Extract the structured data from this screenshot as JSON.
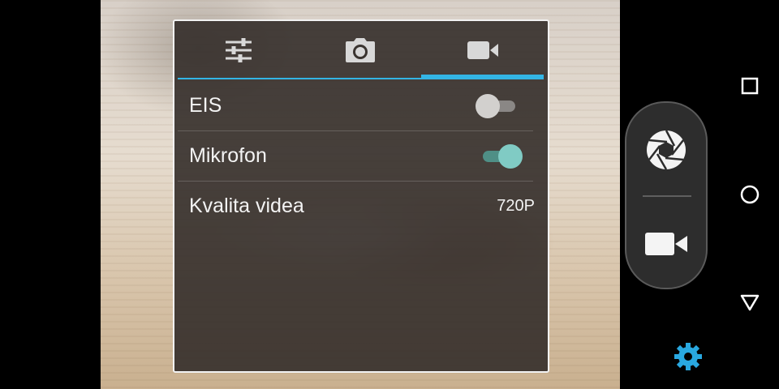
{
  "settings_panel": {
    "tabs": [
      {
        "name": "general-settings",
        "icon": "sliders-icon",
        "active": false
      },
      {
        "name": "photo-settings",
        "icon": "camera-icon",
        "active": false
      },
      {
        "name": "video-settings",
        "icon": "videocam-icon",
        "active": true
      }
    ],
    "rows": [
      {
        "label": "EIS",
        "control": "toggle",
        "checked": false
      },
      {
        "label": "Mikrofon",
        "control": "toggle",
        "checked": true
      },
      {
        "label": "Kvalita videa",
        "control": "value",
        "value": "720P"
      }
    ]
  },
  "shutter": {
    "buttons": [
      {
        "icon": "shutter-aperture-icon"
      },
      {
        "icon": "videocam-icon"
      }
    ]
  },
  "nav": {
    "buttons": [
      {
        "icon": "recents-square-icon"
      },
      {
        "icon": "home-circle-icon"
      },
      {
        "icon": "back-triangle-icon"
      }
    ],
    "settings_icon": "gear-icon"
  },
  "colors": {
    "accent": "#33b5e5",
    "toggle_on": "#80cbc4",
    "gear": "#29a8e0"
  }
}
